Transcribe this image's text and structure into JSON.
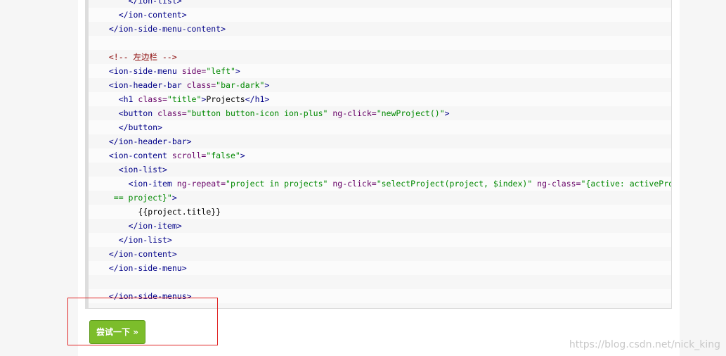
{
  "code": {
    "lines": [
      [
        {
          "t": "tag",
          "v": "      </ion-list>"
        }
      ],
      [
        {
          "t": "tag",
          "v": "    </ion-content>"
        }
      ],
      [
        {
          "t": "tag",
          "v": "  </ion-side-menu-content>"
        }
      ],
      [
        {
          "t": "plain",
          "v": ""
        }
      ],
      [
        {
          "t": "comment",
          "v": "  <!-- 左边栏 -->"
        }
      ],
      [
        {
          "t": "tag",
          "v": "  <ion-side-menu "
        },
        {
          "t": "attr",
          "v": "side="
        },
        {
          "t": "str",
          "v": "\"left\""
        },
        {
          "t": "tag",
          "v": ">"
        }
      ],
      [
        {
          "t": "tag",
          "v": "  <ion-header-bar "
        },
        {
          "t": "attr",
          "v": "class="
        },
        {
          "t": "str",
          "v": "\"bar-dark\""
        },
        {
          "t": "tag",
          "v": ">"
        }
      ],
      [
        {
          "t": "tag",
          "v": "    <h1 "
        },
        {
          "t": "attr",
          "v": "class="
        },
        {
          "t": "str",
          "v": "\"title\""
        },
        {
          "t": "tag",
          "v": ">"
        },
        {
          "t": "plain",
          "v": "Projects"
        },
        {
          "t": "tag",
          "v": "</h1>"
        }
      ],
      [
        {
          "t": "tag",
          "v": "    <button "
        },
        {
          "t": "attr",
          "v": "class="
        },
        {
          "t": "str",
          "v": "\"button button-icon ion-plus\""
        },
        {
          "t": "attr",
          "v": " ng-click="
        },
        {
          "t": "str",
          "v": "\"newProject()\""
        },
        {
          "t": "tag",
          "v": ">"
        }
      ],
      [
        {
          "t": "tag",
          "v": "    </button>"
        }
      ],
      [
        {
          "t": "tag",
          "v": "  </ion-header-bar>"
        }
      ],
      [
        {
          "t": "tag",
          "v": "  <ion-content "
        },
        {
          "t": "attr",
          "v": "scroll="
        },
        {
          "t": "str",
          "v": "\"false\""
        },
        {
          "t": "tag",
          "v": ">"
        }
      ],
      [
        {
          "t": "tag",
          "v": "    <ion-list>"
        }
      ],
      [
        {
          "t": "tag",
          "v": "      <ion-item "
        },
        {
          "t": "attr",
          "v": "ng-repeat="
        },
        {
          "t": "str",
          "v": "\"project in projects\""
        },
        {
          "t": "attr",
          "v": " ng-click="
        },
        {
          "t": "str",
          "v": "\"selectProject(project, $index)\""
        },
        {
          "t": "attr",
          "v": " ng-class="
        },
        {
          "t": "str",
          "v": "\"{active: activeProject"
        }
      ],
      [
        {
          "t": "str",
          "v": "   == project}\""
        },
        {
          "t": "tag",
          "v": ">"
        }
      ],
      [
        {
          "t": "plain",
          "v": "        {{project.title}}"
        }
      ],
      [
        {
          "t": "tag",
          "v": "      </ion-item>"
        }
      ],
      [
        {
          "t": "tag",
          "v": "    </ion-list>"
        }
      ],
      [
        {
          "t": "tag",
          "v": "  </ion-content>"
        }
      ],
      [
        {
          "t": "tag",
          "v": "  </ion-side-menu>"
        }
      ],
      [
        {
          "t": "plain",
          "v": ""
        }
      ],
      [
        {
          "t": "tag",
          "v": "  </ion-side-menus>"
        }
      ],
      [
        {
          "t": "plain",
          "v": ""
        }
      ]
    ]
  },
  "try_button": {
    "label": "尝试一下 »"
  },
  "watermark": {
    "text": "https://blog.csdn.net/nick_king"
  },
  "colors": {
    "button_green": "#7cbd2b",
    "highlight_red": "#e02424",
    "tag": "#000088",
    "attr": "#660066",
    "string": "#008800",
    "comment": "#880000"
  }
}
